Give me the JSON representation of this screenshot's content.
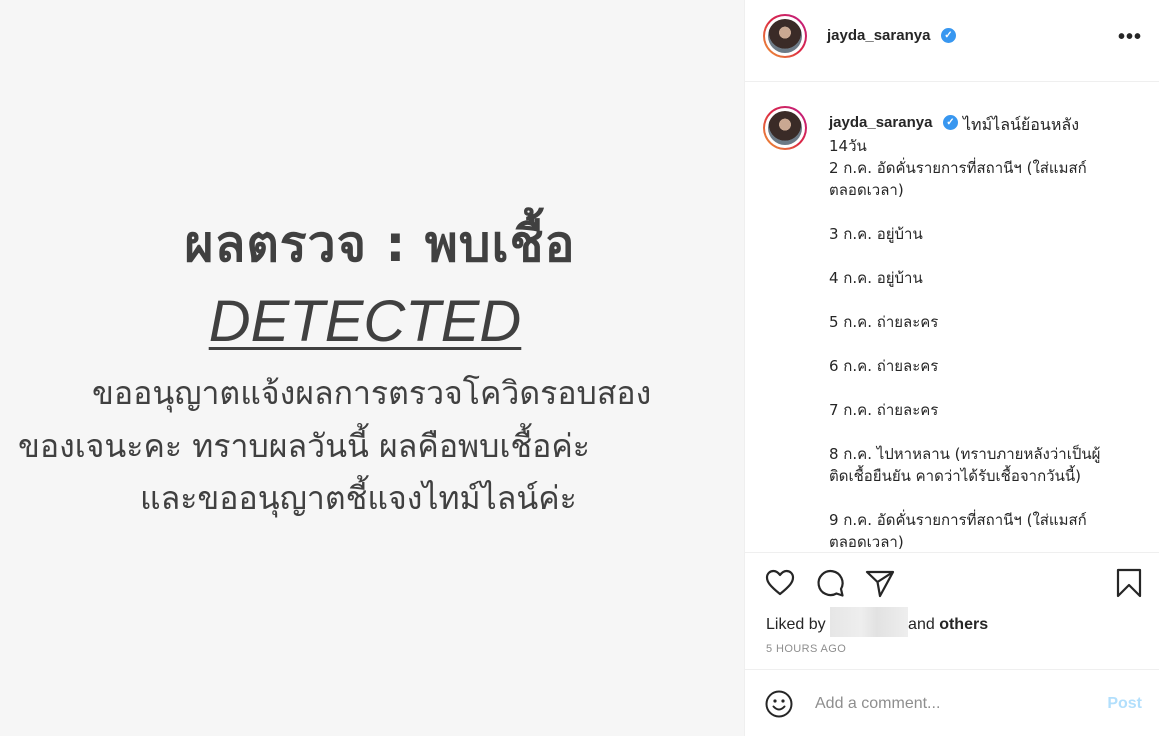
{
  "image": {
    "heading": "ผลตรวจ : พบเชื้อ",
    "detected": "DETECTED",
    "line1": "ขออนุญาตแจ้งผลการตรวจโควิดรอบสอง",
    "line2": "ของเจนะคะ ทราบผลวันนี้ ผลคือพบเชื้อค่ะ",
    "line3": "และขออนุญาตชี้แจงไทม์ไลน์ค่ะ"
  },
  "header": {
    "username": "jayda_saranya",
    "more_label": "•••"
  },
  "caption": {
    "username": "jayda_saranya",
    "first_line": "ไทม์ไลน์ย้อนหลัง",
    "body": "14วัน\n2 ก.ค. อัดคั่นรายการที่สถานีฯ (ใส่แมสก์\nตลอดเวลา)\n\n3 ก.ค. อยู่บ้าน\n\n4 ก.ค. อยู่บ้าน\n\n5 ก.ค. ถ่ายละคร\n\n6 ก.ค. ถ่ายละคร\n\n7 ก.ค. ถ่ายละคร\n\n8 ก.ค. ไปหาหลาน (ทราบภายหลังว่าเป็นผู้\nติดเชื้อยืนยัน คาดว่าได้รับเชื้อจากวันนี้)\n\n9 ก.ค. อัดคั่นรายการที่สถานีฯ (ใส่แมสก์\nตลอดเวลา)"
  },
  "actions": {
    "liked_prefix": "Liked by",
    "liked_and": "and",
    "liked_others": "others",
    "time_ago": "5 HOURS AGO"
  },
  "comment": {
    "placeholder": "Add a comment...",
    "post_label": "Post"
  },
  "colors": {
    "verified": "#3897f0",
    "post_disabled": "#b2dffc"
  }
}
